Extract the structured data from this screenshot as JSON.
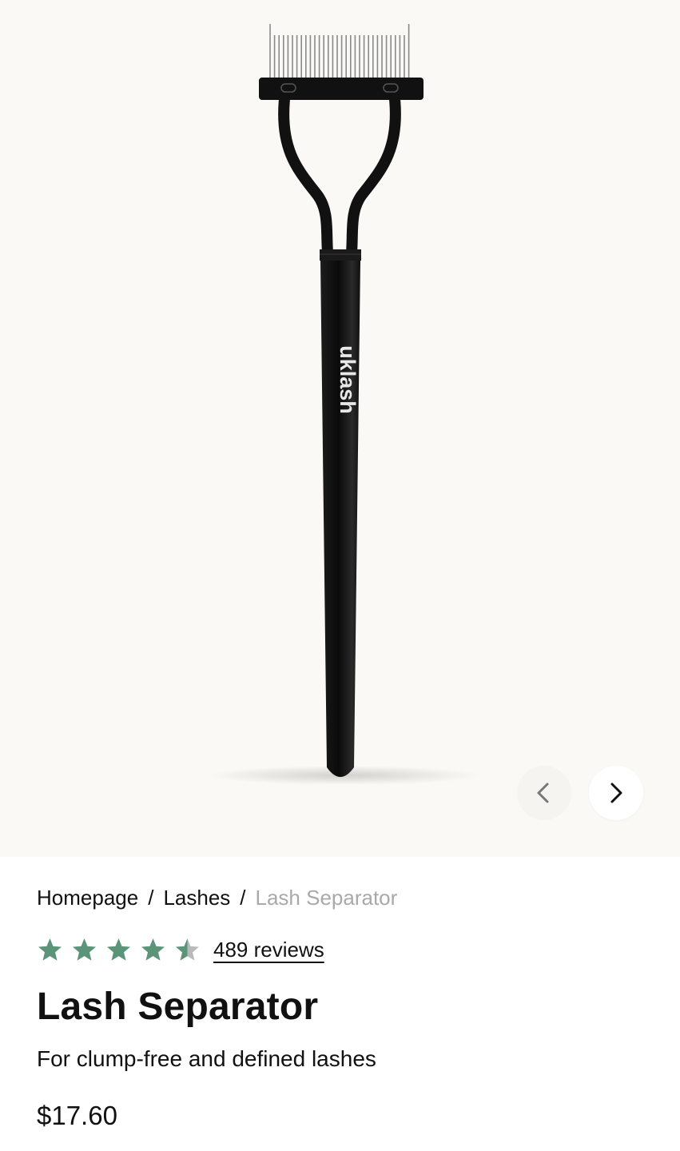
{
  "hero": {
    "brand_mark": "uklash",
    "image_alt": "Lash Separator product photo"
  },
  "carousel": {
    "prev_icon": "chevron-left-icon",
    "next_icon": "chevron-right-icon"
  },
  "breadcrumb": {
    "items": [
      "Homepage",
      "Lashes"
    ],
    "separator": "/",
    "current": "Lash Separator"
  },
  "rating": {
    "value": 4.5,
    "max": 5,
    "reviews_label": "489 reviews",
    "star_color": "#5b9478",
    "star_empty_color": "#b9b9b9"
  },
  "product": {
    "title": "Lash Separator",
    "subtitle": "For clump-free and defined lashes",
    "price": "$17.60"
  },
  "colors": {
    "hero_background": "#fbf9f5",
    "text": "#111111",
    "muted_text": "#a9a9a9"
  }
}
